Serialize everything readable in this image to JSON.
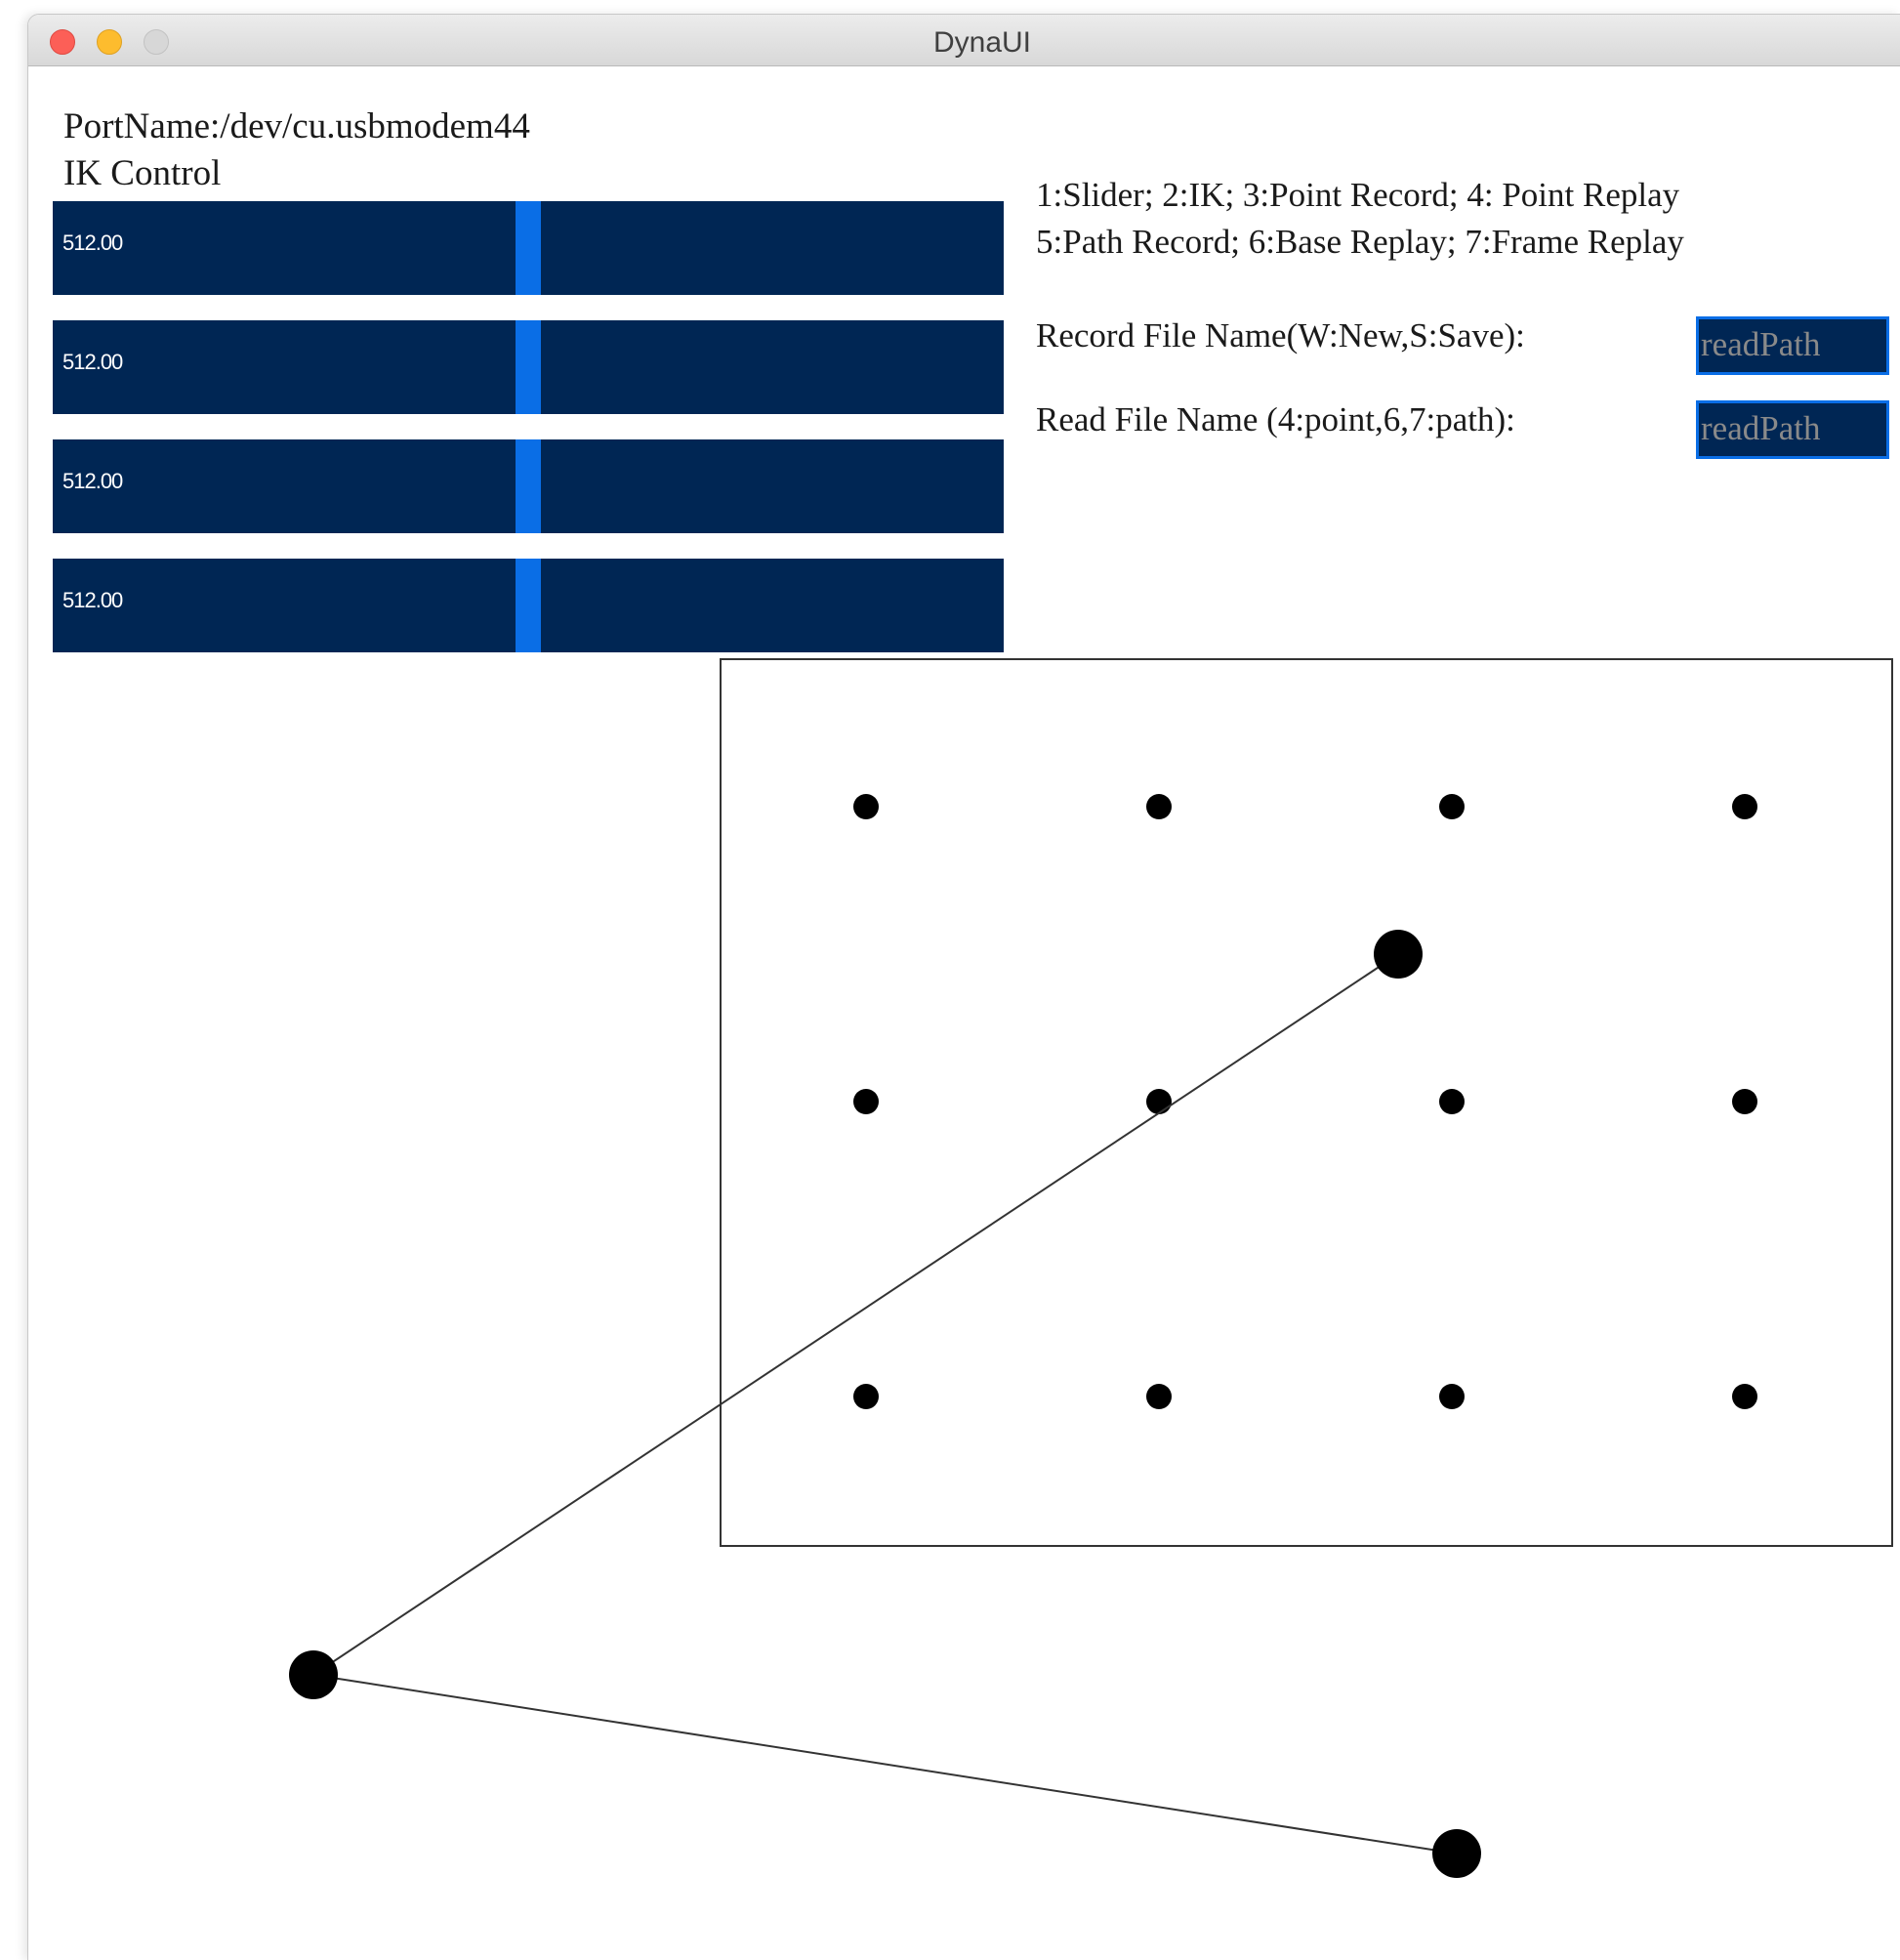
{
  "window": {
    "title": "DynaUI"
  },
  "header": {
    "port_name": "PortName:/dev/cu.usbmodem44",
    "mode_title": "IK Control"
  },
  "sliders": [
    {
      "value_text": "512.00",
      "value": 512,
      "max": 1023,
      "position_fraction": 0.5
    },
    {
      "value_text": "512.00",
      "value": 512,
      "max": 1023,
      "position_fraction": 0.5
    },
    {
      "value_text": "512.00",
      "value": 512,
      "max": 1023,
      "position_fraction": 0.5
    },
    {
      "value_text": "512.00",
      "value": 512,
      "max": 1023,
      "position_fraction": 0.5
    }
  ],
  "help": {
    "line1": "1:Slider; 2:IK; 3:Point Record; 4: Point Replay",
    "line2": "5:Path Record; 6:Base Replay; 7:Frame Replay"
  },
  "files": {
    "record_label": "Record File Name(W:New,S:Save):",
    "record_value": "readPath",
    "read_label": "Read File Name (4:point,6,7:path):",
    "read_value": "readPath"
  },
  "colors": {
    "slider_bg": "#002654",
    "slider_handle": "#0a6ee6",
    "field_border": "#0a6ee6",
    "close": "#fc5f57",
    "minimize": "#fdbc2e",
    "zoom": "#d7d7d7"
  },
  "icons": {
    "close": "close-traffic-light-icon",
    "minimize": "minimize-traffic-light-icon",
    "zoom": "zoom-traffic-light-icon"
  },
  "workspace": {
    "grid_rows": 3,
    "grid_cols": 4,
    "arm_joints": 3
  }
}
